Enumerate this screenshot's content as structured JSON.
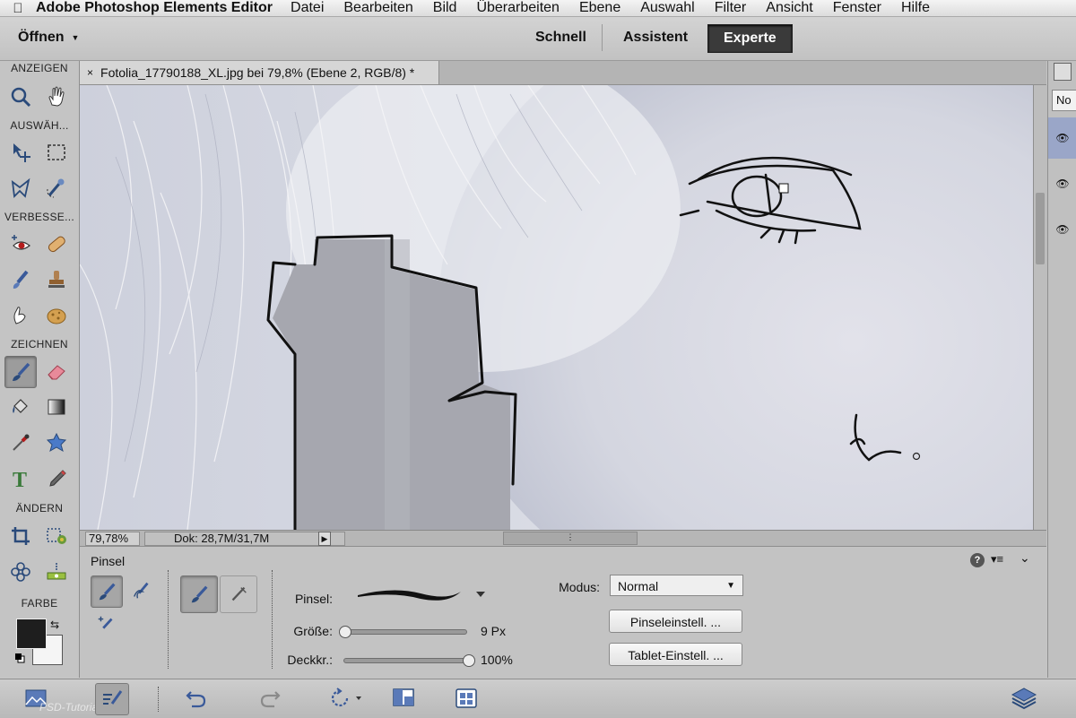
{
  "menubar": {
    "app_name": "Adobe Photoshop Elements Editor",
    "items": [
      "Datei",
      "Bearbeiten",
      "Bild",
      "Überarbeiten",
      "Ebene",
      "Auswahl",
      "Filter",
      "Ansicht",
      "Fenster",
      "Hilfe"
    ]
  },
  "topbar": {
    "open_label": "Öffnen",
    "modes": [
      "Schnell",
      "Assistent",
      "Experte"
    ],
    "active_mode": "Experte"
  },
  "toolbox": {
    "sections": [
      "ANZEIGEN",
      "AUSWÄH...",
      "VERBESSE...",
      "ZEICHNEN",
      "ÄNDERN",
      "FARBE"
    ],
    "active_tool": "brush-tool"
  },
  "document": {
    "tab_title": "Fotolia_17790188_XL.jpg bei 79,8% (Ebene 2, RGB/8) *",
    "close_glyph": "×"
  },
  "status": {
    "zoom": "79,78%",
    "doc_info": "Dok: 28,7M/31,7M"
  },
  "right_panel": {
    "mode_label": "No"
  },
  "options": {
    "title": "Pinsel",
    "brush_label": "Pinsel:",
    "size_label": "Größe:",
    "size_value": "9 Px",
    "size_fraction": 0.0,
    "opacity_label": "Deckkr.:",
    "opacity_value": "100%",
    "opacity_fraction": 1.0,
    "mode_label": "Modus:",
    "mode_value": "Normal",
    "brush_settings_button": "Pinseleinstell. ...",
    "tablet_settings_button": "Tablet-Einstell. ..."
  },
  "taskbar": {
    "watermark": "PSD-Tutorials.de"
  },
  "colors": {
    "foreground": "#1e1e1e",
    "background": "#f5f5f5",
    "selected_layer": "#9aa6c8"
  }
}
